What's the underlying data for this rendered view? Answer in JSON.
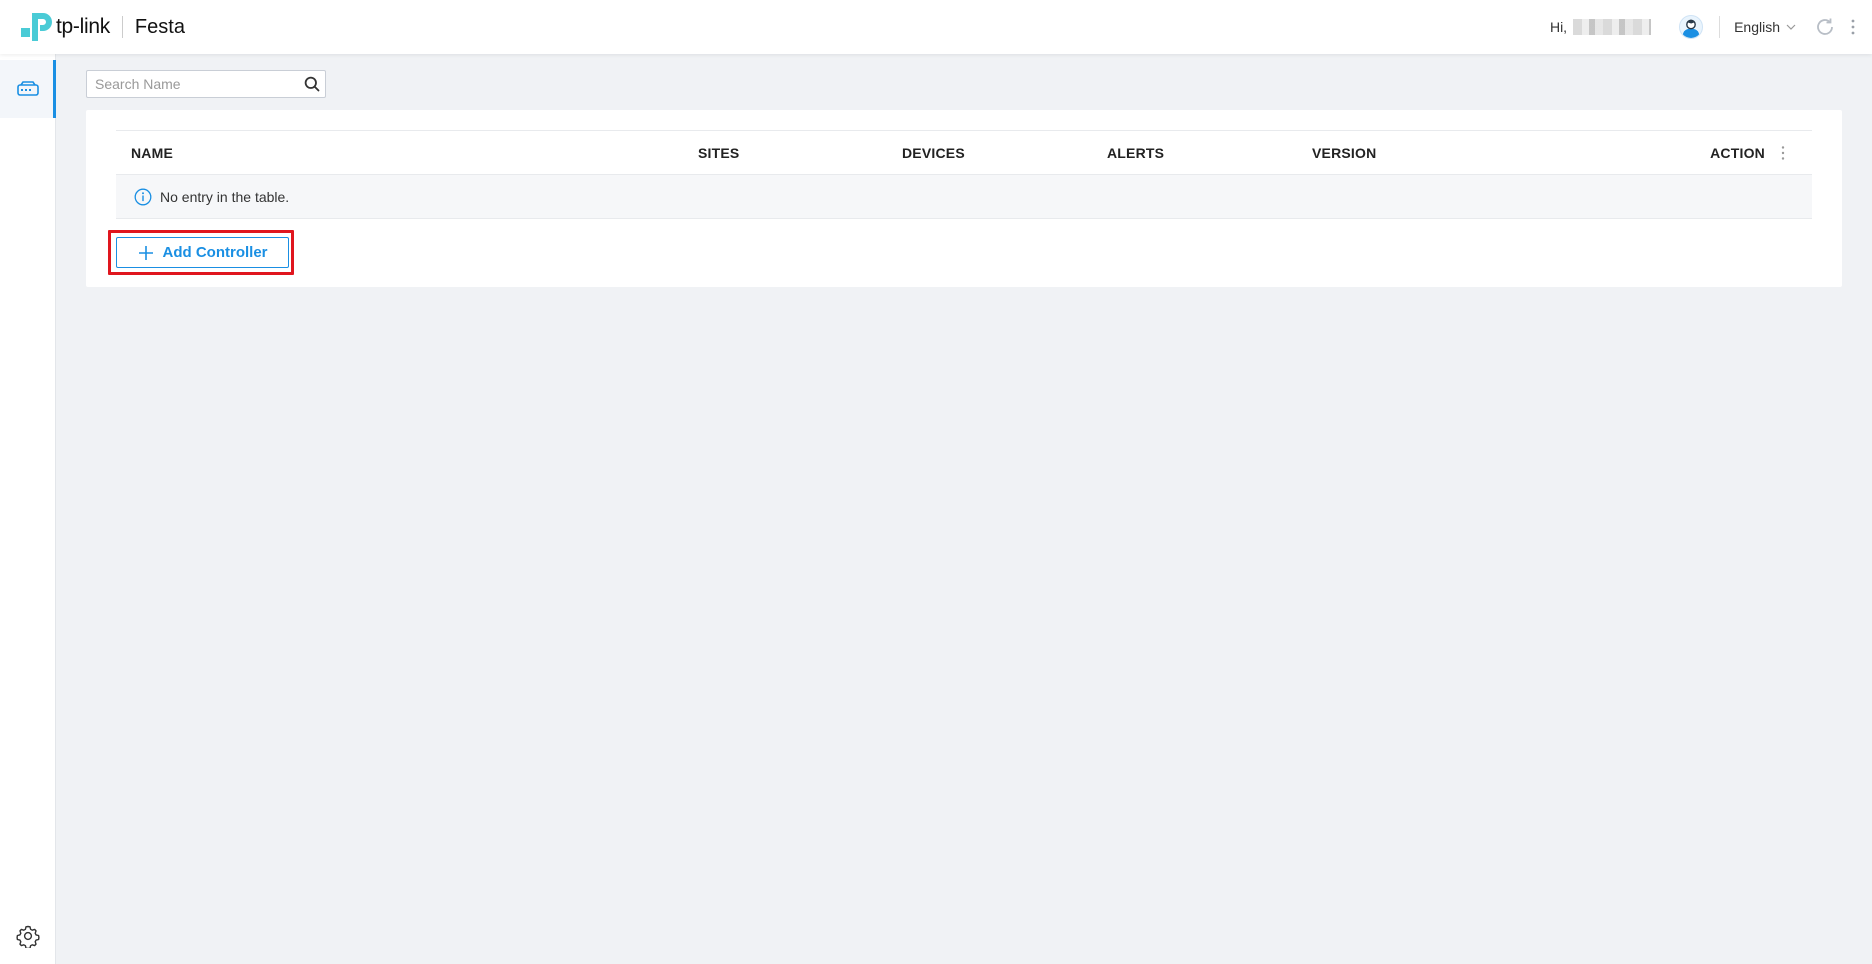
{
  "header": {
    "logo_text": "tp-link",
    "product": "Festa",
    "greeting": "Hi,",
    "language": "English"
  },
  "search": {
    "placeholder": "Search Name",
    "value": ""
  },
  "table": {
    "columns": [
      "NAME",
      "SITES",
      "DEVICES",
      "ALERTS",
      "VERSION",
      "ACTION"
    ],
    "empty_message": "No entry in the table."
  },
  "actions": {
    "add_controller": "Add Controller"
  },
  "colors": {
    "accent": "#1a8fe3",
    "logo_teal": "#4acbd6",
    "highlight": "#e0161e"
  },
  "icons": [
    "tp-link-logo-icon",
    "user-avatar-icon",
    "chevron-down-icon",
    "refresh-icon",
    "more-vertical-icon",
    "controller-icon",
    "settings-gear-icon",
    "search-icon",
    "info-icon",
    "plus-icon"
  ]
}
